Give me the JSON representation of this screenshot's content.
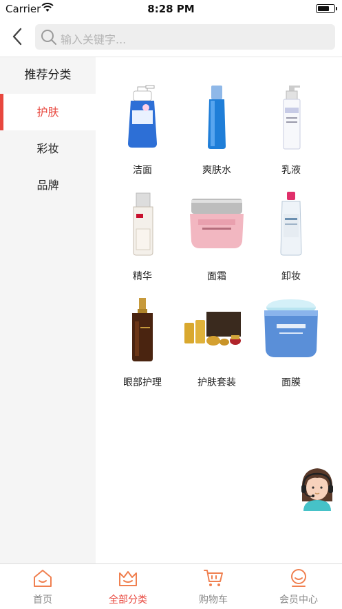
{
  "status_bar": {
    "carrier": "Carrier",
    "time": "8:28 PM",
    "battery_level": 0.75
  },
  "search": {
    "placeholder": "输入关键字..."
  },
  "sidebar": {
    "items": [
      {
        "label": "推荐分类",
        "active": false
      },
      {
        "label": "护肤",
        "active": true
      },
      {
        "label": "彩妆",
        "active": false
      },
      {
        "label": "品牌",
        "active": false
      }
    ]
  },
  "grid": {
    "items": [
      {
        "label": "洁面",
        "icon": "cleanser-bottle"
      },
      {
        "label": "爽肤水",
        "icon": "toner-bottle"
      },
      {
        "label": "乳液",
        "icon": "lotion-bottle"
      },
      {
        "label": "精华",
        "icon": "essence-bottle"
      },
      {
        "label": "面霜",
        "icon": "cream-jar"
      },
      {
        "label": "卸妆",
        "icon": "makeup-remover-bottle"
      },
      {
        "label": "眼部护理",
        "icon": "eye-serum-bottle"
      },
      {
        "label": "护肤套装",
        "icon": "skincare-set"
      },
      {
        "label": "面膜",
        "icon": "mask-jar"
      }
    ]
  },
  "tabbar": {
    "items": [
      {
        "label": "首页",
        "icon": "home-icon",
        "active": false
      },
      {
        "label": "全部分类",
        "icon": "category-icon",
        "active": true
      },
      {
        "label": "购物车",
        "icon": "cart-icon",
        "active": false
      },
      {
        "label": "会员中心",
        "icon": "member-icon",
        "active": false
      }
    ]
  },
  "colors": {
    "accent": "#e8473e",
    "tab_inactive": "#8a8a8a",
    "icon_orange": "#f08050",
    "sidebar_bg": "#f5f5f5"
  }
}
